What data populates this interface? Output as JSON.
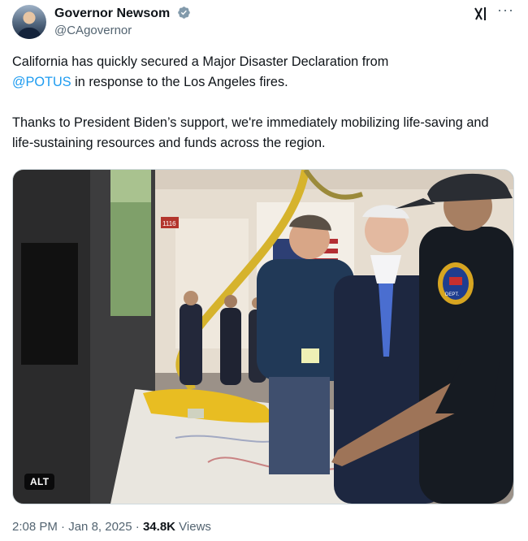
{
  "author": {
    "display_name": "Governor Newsom",
    "handle": "@CAgovernor",
    "verified": true,
    "avatar_icon": "profile-photo"
  },
  "header_icons": {
    "grok": "grok-icon",
    "more": "more-options-icon"
  },
  "tweet": {
    "line1_before": "California has quickly secured a Major Disaster Declaration from",
    "mention": "@POTUS",
    "line1_after": " in response to the Los Angeles fires.",
    "paragraph2": "Thanks to President Biden’s support, we're immediately mobilizing life-saving and life-sustaining resources and funds across the region."
  },
  "media": {
    "alt_label": "ALT",
    "patch_text_top": "SANTA MONICA",
    "patch_text_bottom": "DEPT.",
    "room_sign": "1116"
  },
  "meta": {
    "time": "2:08 PM",
    "sep1": "·",
    "date": "Jan 8, 2025",
    "sep2": "·",
    "views_count": "34.8K",
    "views_label": "Views"
  },
  "colors": {
    "accent": "#1d9bf0",
    "secondary_text": "#536471",
    "primary_text": "#0f1419"
  }
}
